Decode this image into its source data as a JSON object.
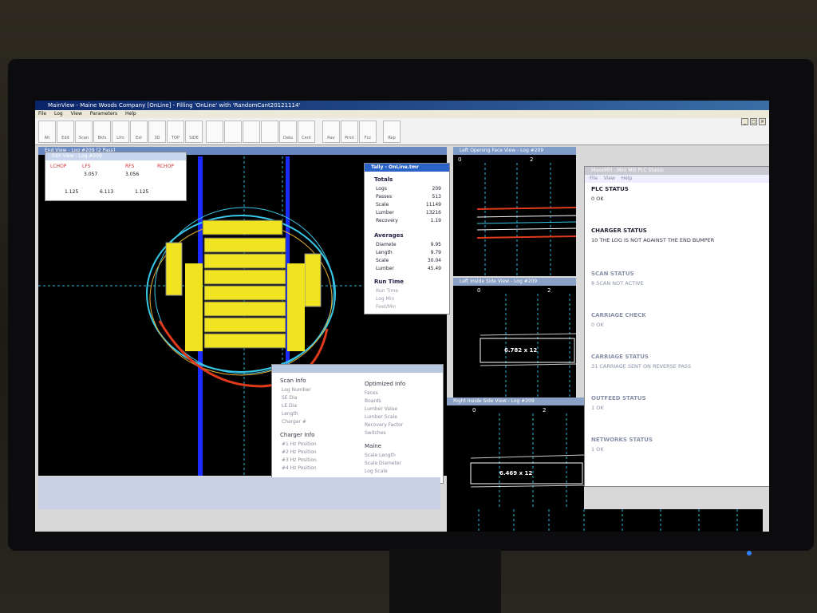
{
  "app": {
    "title": "MainView - Maine Woods Company [OnLine] - Filling 'OnLine' with 'RandomCant20121114'",
    "menu": [
      "File",
      "Log",
      "View",
      "Parameters",
      "Help"
    ],
    "toolbar": [
      "Alt",
      "Edit",
      "Scan",
      "Bkfs",
      "Lfm",
      "Ext",
      "3D",
      "TOP",
      "SIDE",
      "",
      "",
      "",
      "",
      "Data",
      "Cent",
      "Rav",
      "Print",
      "Fcc",
      "Rep"
    ]
  },
  "end_view": {
    "title": "End View - Log #209 [2 Pass]"
  },
  "lcd": {
    "title": "Edit View - Log #209",
    "headers": [
      "LCHOP",
      "LFS",
      "RFS",
      "RCHOP"
    ],
    "row1": [
      "",
      "3.057",
      "3.056",
      ""
    ],
    "row2": [
      "1.125",
      "6.113",
      "1.125"
    ]
  },
  "tally": {
    "title": "Tally - OnLine.tmr",
    "totals_label": "Totals",
    "totals": [
      {
        "label": "Logs",
        "value": "209"
      },
      {
        "label": "Passes",
        "value": "513"
      },
      {
        "label": "Scale",
        "value": "11149"
      },
      {
        "label": "Lumber",
        "value": "13216"
      },
      {
        "label": "Recovery",
        "value": "1.19"
      }
    ],
    "averages_label": "Averages",
    "averages": [
      {
        "label": "Diamete",
        "value": "9.95"
      },
      {
        "label": "Length",
        "value": "9.79"
      },
      {
        "label": "Scale",
        "value": "30.04"
      },
      {
        "label": "Lumber",
        "value": "45.49"
      }
    ],
    "runtime_label": "Run Time",
    "runtime": [
      {
        "label": "Run Time",
        "value": ""
      },
      {
        "label": "Log Min",
        "value": ""
      },
      {
        "label": "Feet/Min",
        "value": ""
      }
    ]
  },
  "scan_info": {
    "scan_header": "Scan Info",
    "scan_items": [
      "Log Number",
      "SE Dia",
      "LE Dia",
      "Length",
      "Charger #"
    ],
    "optimized_header": "Optimized Info",
    "optimized_items": [
      "Faces",
      "Boards",
      "Lumber Value",
      "Lumber Scale",
      "Recovery Factor",
      "Switches"
    ],
    "charger_header": "Charger Info",
    "charger_items": [
      "#1 Hz Position",
      "#2 Hz Position",
      "#3 Hz Position",
      "#4 Hz Position"
    ],
    "maine_header": "Maine",
    "maine_items": [
      "Scale Length",
      "Scale Diameter",
      "Log Scale"
    ]
  },
  "face_view": {
    "title": "Left Opening Face View - Log #209",
    "tick0": "0",
    "tick2": "2"
  },
  "side_view": {
    "title": "Left Inside Side View - Log #209",
    "tick0": "0",
    "tick2": "2",
    "board": "6.782 x 12"
  },
  "right_view": {
    "title": "Right Inside Side View - Log #209",
    "tick0": "0",
    "tick2": "2",
    "board": "6.469 x 12"
  },
  "plc": {
    "title": "MaxxMill - Mini Mill PLC Status",
    "menu": [
      "File",
      "View",
      "Help"
    ],
    "items": [
      {
        "heading": "PLC STATUS",
        "value": "0 OK"
      },
      {
        "heading": "CHARGER STATUS",
        "value": "10 THE LOG IS NOT AGAINST THE END BUMPER"
      },
      {
        "heading": "SCAN STATUS",
        "value": "8 SCAN NOT ACTIVE"
      },
      {
        "heading": "CARRIAGE CHECK",
        "value": "0 OK"
      },
      {
        "heading": "CARRIAGE STATUS",
        "value": "31 CARRIAGE SENT ON REVERSE PASS"
      },
      {
        "heading": "OUTFEED STATUS",
        "value": "1 OK"
      },
      {
        "heading": "NETWORKS STATUS",
        "value": "1 OK"
      }
    ]
  },
  "colors": {
    "log_board": "#f0e420",
    "outline_cyan": "#3ac8e8",
    "outline_red": "#e03a1a",
    "guide_blue": "#1a2cff",
    "grid_cyan": "#28b8e0"
  }
}
